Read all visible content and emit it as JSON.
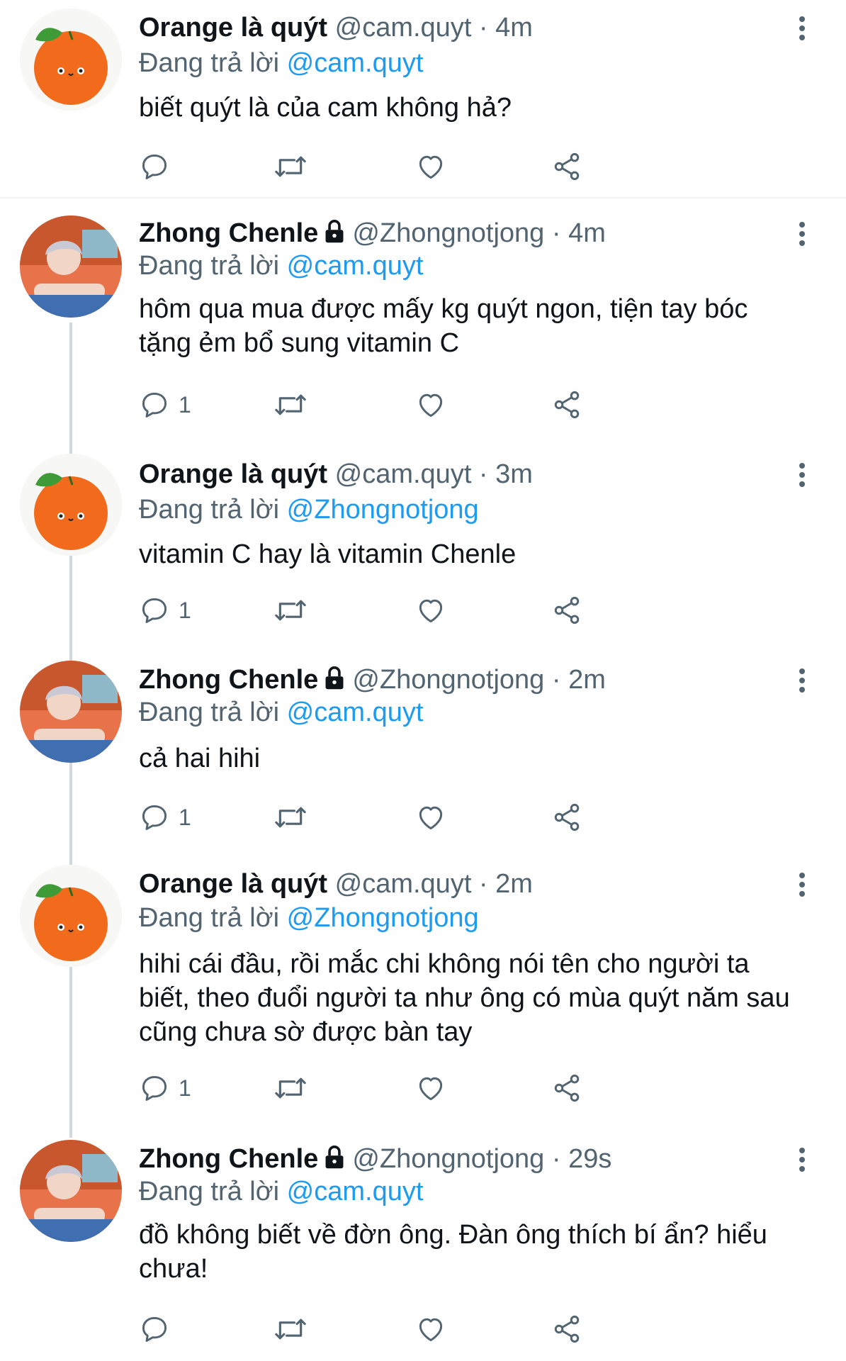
{
  "accounts": {
    "orange": {
      "name": "Orange là quýt",
      "handle": "@cam.quyt"
    },
    "zhong": {
      "name": "Zhong Chenle",
      "handle": "@Zhongnotjong"
    }
  },
  "replying_prefix": "Đang trả lời",
  "tweets": [
    {
      "name": "Orange là quýt",
      "meta": "@cam.quyt · 4m",
      "reply_to": "@cam.quyt",
      "text": "biết quýt là của cam không hả?",
      "reply_count": ""
    },
    {
      "name": "Zhong Chenle",
      "meta": "@Zhongnotjong · 4m",
      "reply_to": "@cam.quyt",
      "text": "hôm qua mua được mấy kg quýt ngon, tiện tay bóc tặng ẻm bổ sung vitamin C",
      "reply_count": "1"
    },
    {
      "name": "Orange là quýt",
      "meta": "@cam.quyt · 3m",
      "reply_to": "@Zhongnotjong",
      "text": "vitamin C hay là vitamin Chenle",
      "reply_count": "1"
    },
    {
      "name": "Zhong Chenle",
      "meta": "@Zhongnotjong · 2m",
      "reply_to": "@cam.quyt",
      "text": "cả hai hihi",
      "reply_count": "1"
    },
    {
      "name": "Orange là quýt",
      "meta": "@cam.quyt · 2m",
      "reply_to": "@Zhongnotjong",
      "text": "hihi cái đầu, rồi mắc chi không nói tên cho người ta biết, theo đuổi người ta như ông có mùa quýt năm sau cũng chưa sờ được bàn tay",
      "reply_count": "1"
    },
    {
      "name": "Zhong Chenle",
      "meta": "@Zhongnotjong · 29s",
      "reply_to": "@cam.quyt",
      "text": "đồ không biết về đờn ông. Đàn ông thích bí ẩn? hiểu chưa!",
      "reply_count": ""
    }
  ],
  "icons": {
    "reply": "reply-icon",
    "retweet": "retweet-icon",
    "like": "heart-icon",
    "share": "share-icon",
    "more": "more-icon",
    "lock": "lock-icon"
  },
  "colors": {
    "link": "#1d9bf0",
    "secondary": "#536471",
    "orange": "#f26a1b"
  }
}
